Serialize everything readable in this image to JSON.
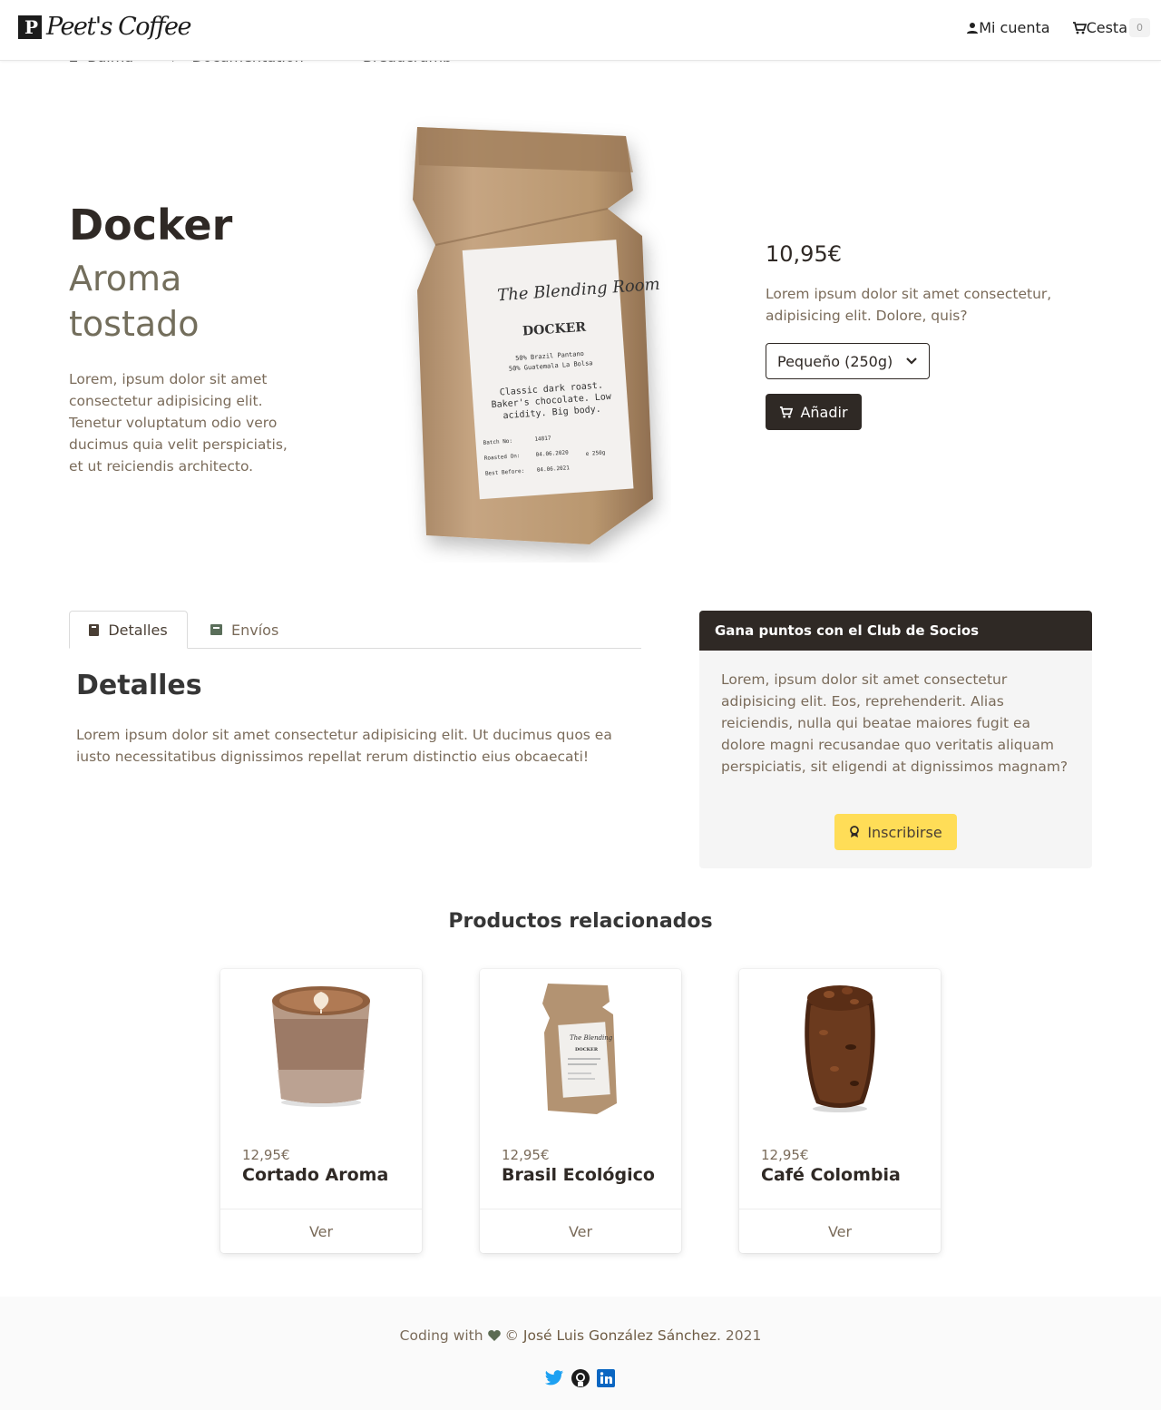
{
  "header": {
    "brand": "Peet's Coffee",
    "account_label": "Mi cuenta",
    "cart_label": "Cesta",
    "cart_count": "0"
  },
  "breadcrumbs": [
    "Bulma",
    "Documentation",
    "Breadcrumb"
  ],
  "product": {
    "name": "Docker",
    "subtitle": "Aroma tostado",
    "description": "Lorem, ipsum dolor sit amet consectetur adipisicing elit. Tenetur voluptatum odio vero ducimus quia velit perspiciatis, et ut reiciendis architecto.",
    "price": "10,95€",
    "short_description": "Lorem ipsum dolor sit amet consectetur, adipisicing elit. Dolore, quis?",
    "size_selected": "Pequeño (250g)",
    "add_label": "Añadir",
    "bag_label": {
      "brand": "The Blending Room",
      "name": "DOCKER",
      "origin1": "50% Brazil Pantano",
      "origin2": "50% Guatemala La Bolsa",
      "notes1": "Classic dark roast.",
      "notes2": "Baker's chocolate. Low",
      "notes3": "acidity. Big body.",
      "batch_label": "Batch No:",
      "batch": "14817",
      "roasted_label": "Roasted On:",
      "roasted": "04.06.2020",
      "weight": "e 250g",
      "best_label": "Best Before:",
      "best": "04.06.2021"
    }
  },
  "tabs": [
    {
      "label": "Detalles",
      "active": true
    },
    {
      "label": "Envíos",
      "active": false
    }
  ],
  "details": {
    "title": "Detalles",
    "text": "Lorem ipsum dolor sit amet consectetur adipisicing elit. Ut ducimus quos ea iusto necessitatibus dignissimos repellat rerum distinctio eius obcaecati!"
  },
  "club": {
    "title": "Gana puntos con el Club de Socios",
    "text": "Lorem, ipsum dolor sit amet consectetur adipisicing elit. Eos, reprehenderit. Alias reiciendis, nulla qui beatae maiores fugit ea dolore magni recusandae quo veritatis aliquam perspiciatis, sit eligendi at dignissimos magnam?",
    "button": "Inscribirse"
  },
  "related": {
    "title": "Productos relacionados",
    "items": [
      {
        "price": "12,95€",
        "name": "Cortado Aroma",
        "action": "Ver"
      },
      {
        "price": "12,95€",
        "name": "Brasil Ecológico",
        "action": "Ver"
      },
      {
        "price": "12,95€",
        "name": "Café Colombia",
        "action": "Ver"
      }
    ]
  },
  "footer": {
    "prefix": "Coding with",
    "copyright": "©",
    "author": "José Luis González Sánchez",
    "year": ". 2021"
  },
  "colors": {
    "dark": "#2f2925",
    "muted": "#7a6b5a",
    "accent": "#ffdd57",
    "twitter": "#1da1f2",
    "linkedin": "#0a66c2"
  },
  "icons": [
    "user-icon",
    "cart-icon",
    "chevron-down-icon",
    "book-icon",
    "box-icon",
    "award-icon",
    "heart-icon",
    "twitter-icon",
    "github-icon",
    "linkedin-icon"
  ]
}
